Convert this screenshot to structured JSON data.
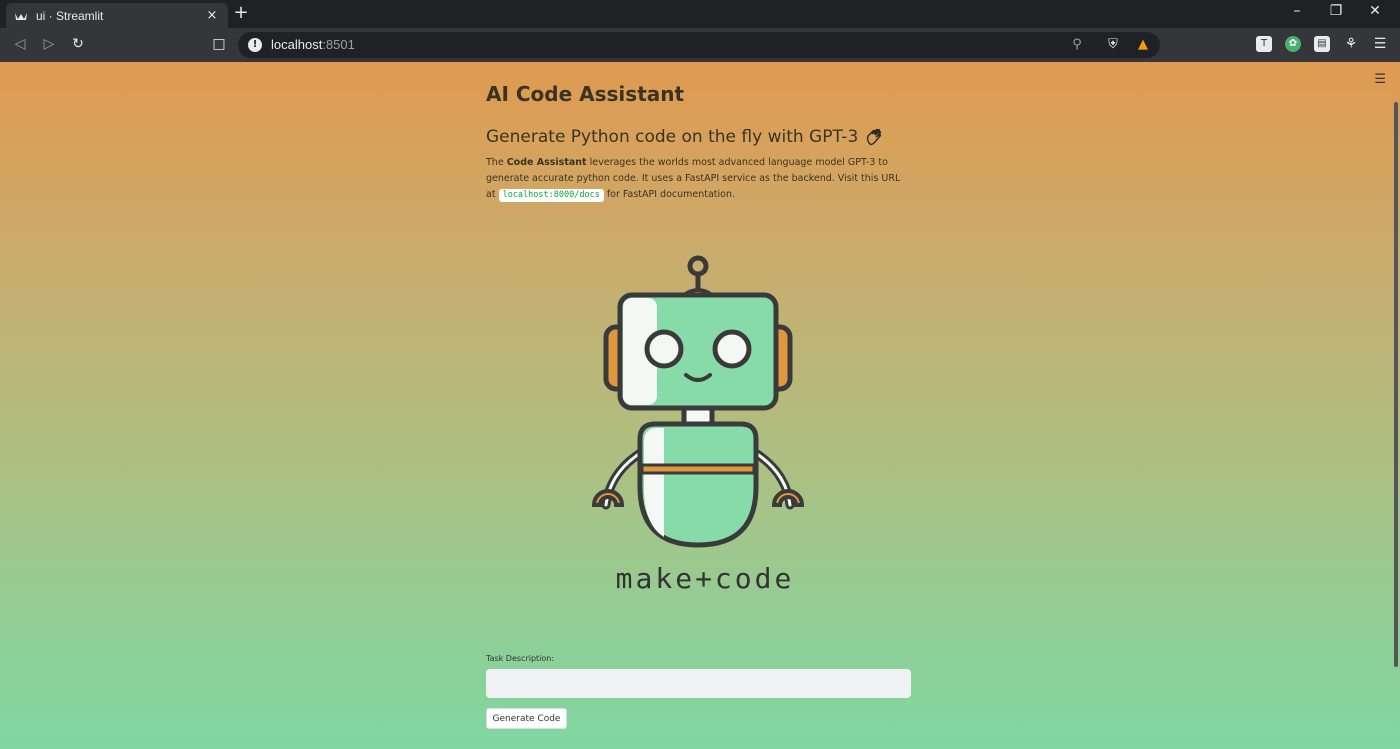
{
  "browser": {
    "tab_title": "ui · Streamlit",
    "tab_close": "×",
    "new_tab": "+",
    "url_host": "localhost",
    "url_port": ":8501"
  },
  "app": {
    "title": "AI Code Assistant",
    "subtitle": "Generate Python code on the fly with GPT-3",
    "desc_prefix": "The ",
    "desc_bold": "Code Assistant",
    "desc_mid": " leverages the worlds most advanced language model GPT-3 to generate accurate python code. It uses a FastAPI service as the backend. Visit this URL at ",
    "desc_code": "localhost:8000/docs",
    "desc_suffix": " for FastAPI documentation.",
    "logo_text": "make+code",
    "task_label": "Task Description:",
    "task_value": "",
    "button_label": "Generate Code"
  },
  "colors": {
    "gradient_top": "#e09a50",
    "gradient_bottom": "#80d7a0",
    "robot_green": "#86dba8",
    "robot_orange": "#e0973f",
    "outline": "#3a3a3a"
  }
}
